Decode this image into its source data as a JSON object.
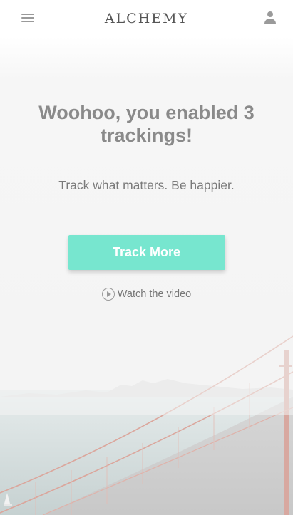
{
  "header": {
    "logo_text": "ALCHEMY",
    "menu_icon": "hamburger-menu-icon",
    "profile_icon": "person-icon"
  },
  "hero": {
    "title": "Woohoo, you enabled 3 trackings!",
    "subtitle": "Track what matters. Be happier.",
    "cta_label": "Track More",
    "video_link_label": "Watch the video",
    "video_icon": "play-circle-icon"
  },
  "colors": {
    "accent": "#77e6cf",
    "title_text": "#8a8a8a",
    "icon_gray": "#9a9a9a"
  }
}
